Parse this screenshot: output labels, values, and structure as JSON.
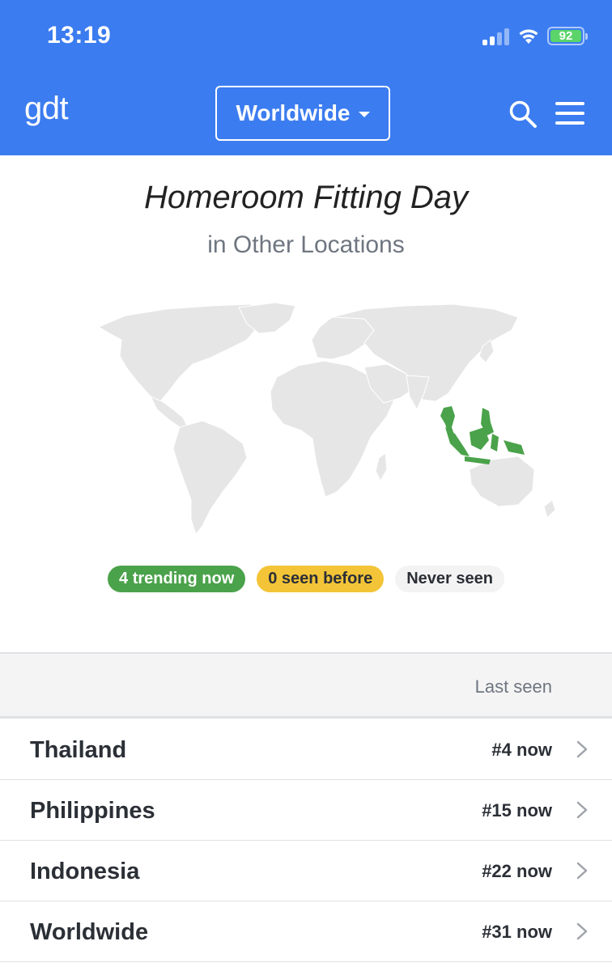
{
  "status_bar": {
    "time": "13:19",
    "battery": "92"
  },
  "header": {
    "logo": "gdt",
    "region": "Worldwide"
  },
  "topic": {
    "title": "Homeroom Fitting Day",
    "subtitle": "in Other Locations"
  },
  "legend": {
    "trending": "4 trending now",
    "seen_before": "0 seen before",
    "never_seen": "Never seen"
  },
  "table": {
    "column_header": "Last seen",
    "rows": [
      {
        "name": "Thailand",
        "rank": "#4 now"
      },
      {
        "name": "Philippines",
        "rank": "#15 now"
      },
      {
        "name": "Indonesia",
        "rank": "#22 now"
      },
      {
        "name": "Worldwide",
        "rank": "#31 now"
      }
    ]
  },
  "colors": {
    "brand": "#3b7cf0",
    "trending": "#4aa24a",
    "seen_before": "#f3c437",
    "never_seen": "#f3f3f3",
    "map_land": "#e6e6e6"
  }
}
